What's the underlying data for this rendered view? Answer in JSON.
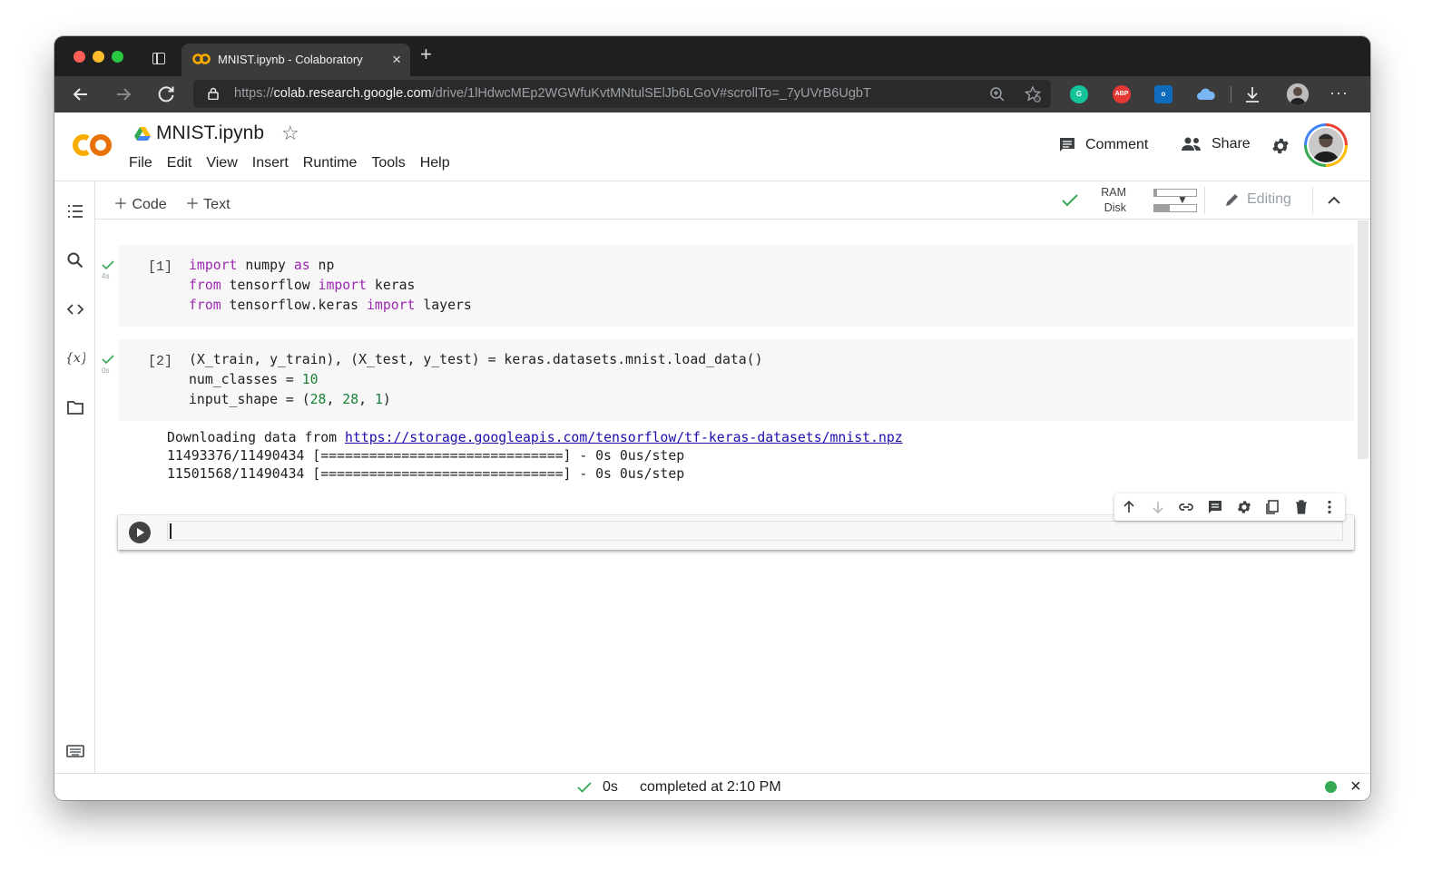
{
  "browser": {
    "tab_title": "MNIST.ipynb - Colaboratory",
    "url_scheme": "https://",
    "url_host": "colab.research.google.com",
    "url_path": "/drive/1lHdwcMEp2WGWfuKvtMNtulSElJb6LGoV#scrollTo=_7yUVrB6UgbT",
    "extensions": [
      "grammarly-icon",
      "adblock-plus-icon",
      "outlook-icon",
      "onedrive-icon"
    ],
    "abp_label": "ABP"
  },
  "header": {
    "notebook_title": "MNIST.ipynb",
    "menu": [
      "File",
      "Edit",
      "View",
      "Insert",
      "Runtime",
      "Tools",
      "Help"
    ],
    "comment_label": "Comment",
    "share_label": "Share"
  },
  "toolbar": {
    "code_label": "Code",
    "text_label": "Text",
    "ram_label": "RAM",
    "disk_label": "Disk",
    "ram_usage": 0.06,
    "disk_usage": 0.38,
    "editing_label": "Editing"
  },
  "cells": [
    {
      "exec_count": "[1]",
      "duration": "4s",
      "code": [
        "import numpy as np",
        "from tensorflow import keras",
        "from tensorflow.keras import layers"
      ]
    },
    {
      "exec_count": "[2]",
      "duration": "0s",
      "code": [
        "(X_train, y_train), (X_test, y_test) = keras.datasets.mnist.load_data()",
        "num_classes = 10",
        "input_shape = (28, 28, 1)"
      ],
      "output": {
        "download_prefix": "Downloading data from ",
        "download_url": "https://storage.googleapis.com/tensorflow/tf-keras-datasets/mnist.npz",
        "line2": "11493376/11490434 [==============================] - 0s 0us/step",
        "line3": "11501568/11490434 [==============================] - 0s 0us/step"
      }
    }
  ],
  "status": {
    "duration": "0s",
    "completed": "completed at 2:10 PM"
  },
  "colors": {
    "keyword": "#9c27b0",
    "number": "#188038",
    "link": "#1a0dab",
    "check": "#34a853",
    "colab_orange": "#f9ab00"
  }
}
